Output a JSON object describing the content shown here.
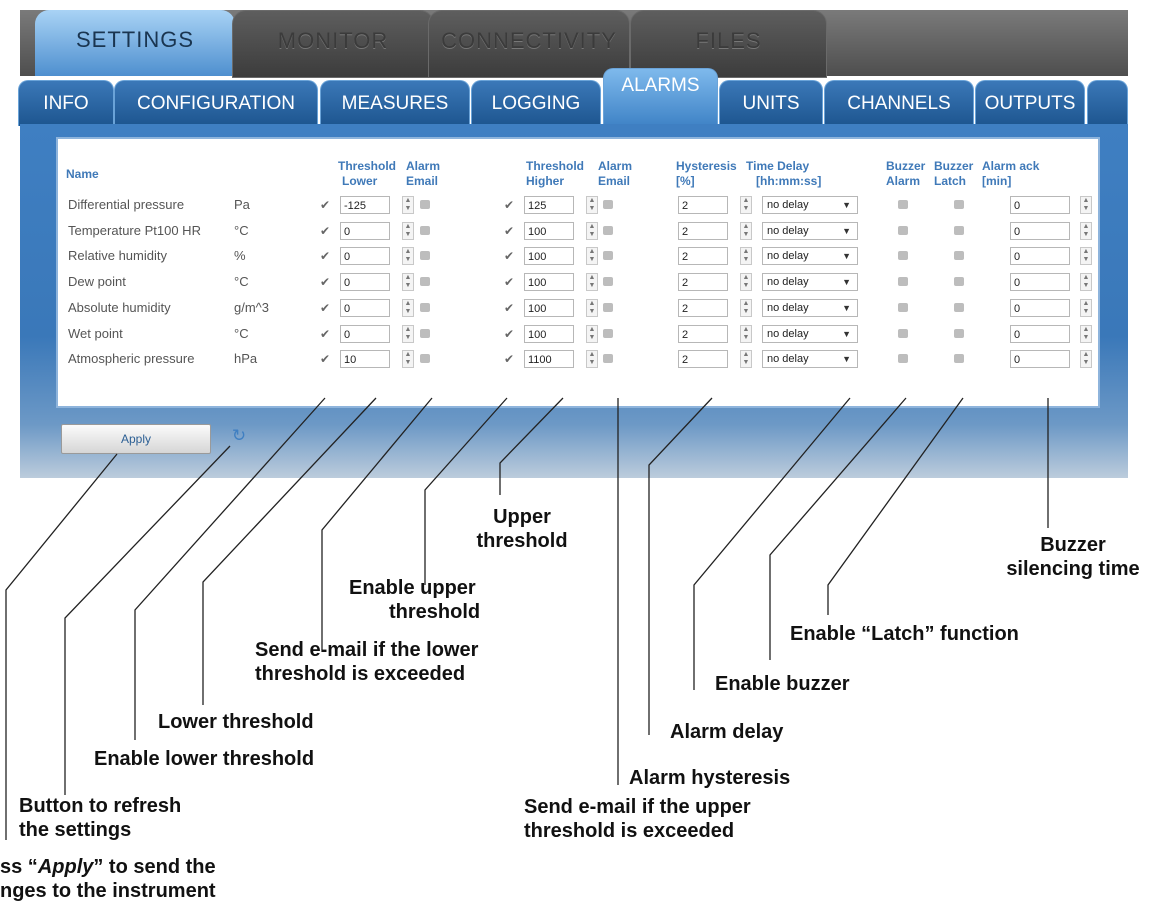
{
  "main_tabs": [
    {
      "label": "SETTINGS",
      "active": true
    },
    {
      "label": "MONITOR",
      "active": false
    },
    {
      "label": "CONNECTIVITY",
      "active": false
    },
    {
      "label": "FILES",
      "active": false
    }
  ],
  "sub_tabs": [
    {
      "label": "INFO"
    },
    {
      "label": "CONFIGURATION"
    },
    {
      "label": "MEASURES"
    },
    {
      "label": "LOGGING"
    },
    {
      "label": "ALARMS",
      "active": true
    },
    {
      "label": "UNITS"
    },
    {
      "label": "CHANNELS"
    },
    {
      "label": "OUTPUTS"
    }
  ],
  "headers": {
    "name": "Name",
    "threshold_lower_1": "Threshold",
    "threshold_lower_2": "Lower",
    "alarm_email_lower_1": "Alarm",
    "alarm_email_lower_2": "Email",
    "threshold_higher_1": "Threshold",
    "threshold_higher_2": "Higher",
    "alarm_email_higher_1": "Alarm",
    "alarm_email_higher_2": "Email",
    "hysteresis_1": "Hysteresis",
    "hysteresis_2": "[%]",
    "time_delay_1": "Time Delay",
    "time_delay_2": "[hh:mm:ss]",
    "buzzer_alarm_1": "Buzzer",
    "buzzer_alarm_2": "Alarm",
    "buzzer_latch_1": "Buzzer",
    "buzzer_latch_2": "Latch",
    "alarm_ack_1": "Alarm ack",
    "alarm_ack_2": "[min]"
  },
  "rows": [
    {
      "name": "Differential pressure",
      "unit": "Pa",
      "lower": "-125",
      "higher": "125",
      "hysteresis": "2",
      "delay": "no delay",
      "ack": "0"
    },
    {
      "name": "Temperature Pt100 HR",
      "unit": "°C",
      "lower": "0",
      "higher": "100",
      "hysteresis": "2",
      "delay": "no delay",
      "ack": "0"
    },
    {
      "name": "Relative humidity",
      "unit": "%",
      "lower": "0",
      "higher": "100",
      "hysteresis": "2",
      "delay": "no delay",
      "ack": "0"
    },
    {
      "name": "Dew point",
      "unit": "°C",
      "lower": "0",
      "higher": "100",
      "hysteresis": "2",
      "delay": "no delay",
      "ack": "0"
    },
    {
      "name": "Absolute humidity",
      "unit": "g/m^3",
      "lower": "0",
      "higher": "100",
      "hysteresis": "2",
      "delay": "no delay",
      "ack": "0"
    },
    {
      "name": "Wet point",
      "unit": "°C",
      "lower": "0",
      "higher": "100",
      "hysteresis": "2",
      "delay": "no delay",
      "ack": "0"
    },
    {
      "name": "Atmospheric pressure",
      "unit": "hPa",
      "lower": "10",
      "higher": "1100",
      "hysteresis": "2",
      "delay": "no delay",
      "ack": "0"
    }
  ],
  "apply_label": "Apply",
  "icons": {
    "refresh": "refresh-icon",
    "checkbox_checked": "checkbox-checked-icon",
    "spinner": "spinner-arrows-icon"
  },
  "annotations": {
    "upper_threshold_1": "Upper",
    "upper_threshold_2": "threshold",
    "buzzer_silencing_1": "Buzzer",
    "buzzer_silencing_2": "silencing time",
    "enable_upper_1": "Enable upper",
    "enable_upper_2": "threshold",
    "enable_latch": "Enable “Latch” function",
    "send_email_lower_1": "Send e-mail if the lower",
    "send_email_lower_2": "threshold is exceeded",
    "enable_buzzer": "Enable buzzer",
    "lower_threshold": "Lower threshold",
    "alarm_delay": "Alarm delay",
    "enable_lower": "Enable lower threshold",
    "alarm_hysteresis": "Alarm hysteresis",
    "refresh_1": "Button to refresh",
    "refresh_2": "the settings",
    "send_email_upper_1": "Send e-mail if the upper",
    "send_email_upper_2": "threshold is exceeded",
    "apply_note_1_pre": "ss “",
    "apply_note_1_em": "Apply",
    "apply_note_1_post": "” to send the",
    "apply_note_2": "nges to the instrument"
  }
}
